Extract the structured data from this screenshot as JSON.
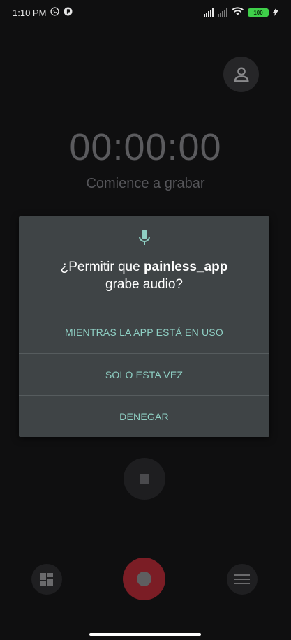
{
  "status_bar": {
    "time": "1:10 PM",
    "battery": "100"
  },
  "recorder": {
    "timer": "00:00:00",
    "subtitle": "Comience a grabar"
  },
  "dialog": {
    "title_prefix": "¿Permitir que ",
    "app_name": "painless_app",
    "title_suffix": "grabe audio?",
    "options": [
      "MIENTRAS LA APP ESTÁ EN USO",
      "SOLO ESTA VEZ",
      "DENEGAR"
    ]
  },
  "colors": {
    "accent": "#8fd0c4",
    "dialog_bg": "#3f4446",
    "record": "#7b1d25"
  }
}
